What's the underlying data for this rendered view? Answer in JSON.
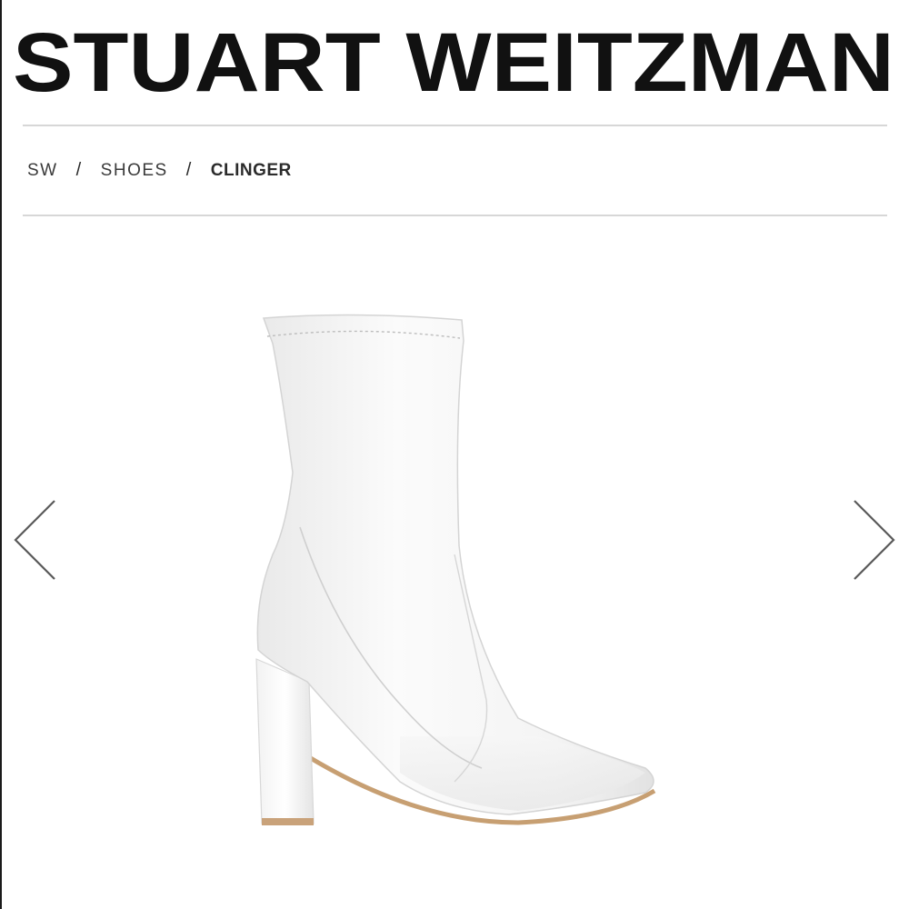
{
  "header": {
    "brand": "STUART WEITZMAN"
  },
  "breadcrumb": {
    "items": [
      "SW",
      "SHOES"
    ],
    "separator": "/",
    "current": "CLINGER"
  },
  "product": {
    "image_alt": "white stretch boot with block heel"
  },
  "carousel": {
    "prev_icon": "chevron-left-icon",
    "next_icon": "chevron-right-icon"
  }
}
